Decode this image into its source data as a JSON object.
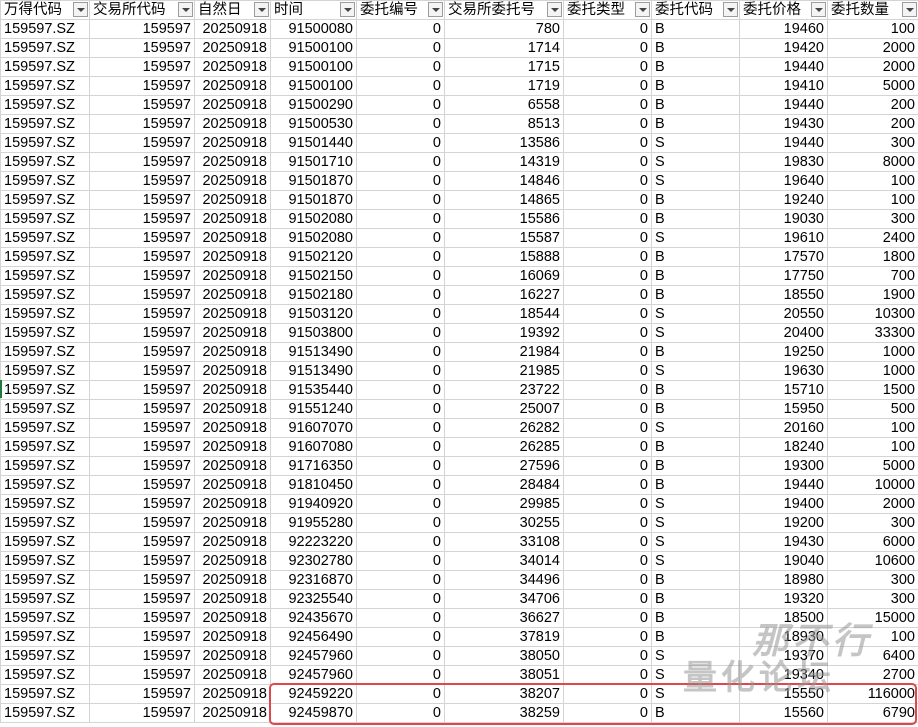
{
  "columns": [
    "万得代码",
    "交易所代码",
    "自然日",
    "时间",
    "委托编号",
    "交易所委托号",
    "委托类型",
    "委托代码",
    "委托价格",
    "委托数量"
  ],
  "rows": [
    [
      "159597.SZ",
      "159597",
      "20250918",
      "91500080",
      "0",
      "780",
      "0",
      "B",
      "19460",
      "100"
    ],
    [
      "159597.SZ",
      "159597",
      "20250918",
      "91500100",
      "0",
      "1714",
      "0",
      "B",
      "19420",
      "2000"
    ],
    [
      "159597.SZ",
      "159597",
      "20250918",
      "91500100",
      "0",
      "1715",
      "0",
      "B",
      "19440",
      "2000"
    ],
    [
      "159597.SZ",
      "159597",
      "20250918",
      "91500100",
      "0",
      "1719",
      "0",
      "B",
      "19410",
      "5000"
    ],
    [
      "159597.SZ",
      "159597",
      "20250918",
      "91500290",
      "0",
      "6558",
      "0",
      "B",
      "19440",
      "200"
    ],
    [
      "159597.SZ",
      "159597",
      "20250918",
      "91500530",
      "0",
      "8513",
      "0",
      "B",
      "19430",
      "200"
    ],
    [
      "159597.SZ",
      "159597",
      "20250918",
      "91501440",
      "0",
      "13586",
      "0",
      "S",
      "19440",
      "300"
    ],
    [
      "159597.SZ",
      "159597",
      "20250918",
      "91501710",
      "0",
      "14319",
      "0",
      "S",
      "19830",
      "8000"
    ],
    [
      "159597.SZ",
      "159597",
      "20250918",
      "91501870",
      "0",
      "14846",
      "0",
      "S",
      "19640",
      "100"
    ],
    [
      "159597.SZ",
      "159597",
      "20250918",
      "91501870",
      "0",
      "14865",
      "0",
      "B",
      "19240",
      "100"
    ],
    [
      "159597.SZ",
      "159597",
      "20250918",
      "91502080",
      "0",
      "15586",
      "0",
      "B",
      "19030",
      "300"
    ],
    [
      "159597.SZ",
      "159597",
      "20250918",
      "91502080",
      "0",
      "15587",
      "0",
      "S",
      "19610",
      "2400"
    ],
    [
      "159597.SZ",
      "159597",
      "20250918",
      "91502120",
      "0",
      "15888",
      "0",
      "B",
      "17570",
      "1800"
    ],
    [
      "159597.SZ",
      "159597",
      "20250918",
      "91502150",
      "0",
      "16069",
      "0",
      "B",
      "17750",
      "700"
    ],
    [
      "159597.SZ",
      "159597",
      "20250918",
      "91502180",
      "0",
      "16227",
      "0",
      "B",
      "18550",
      "1900"
    ],
    [
      "159597.SZ",
      "159597",
      "20250918",
      "91503120",
      "0",
      "18544",
      "0",
      "S",
      "20550",
      "10300"
    ],
    [
      "159597.SZ",
      "159597",
      "20250918",
      "91503800",
      "0",
      "19392",
      "0",
      "S",
      "20400",
      "33300"
    ],
    [
      "159597.SZ",
      "159597",
      "20250918",
      "91513490",
      "0",
      "21984",
      "0",
      "B",
      "19250",
      "1000"
    ],
    [
      "159597.SZ",
      "159597",
      "20250918",
      "91513490",
      "0",
      "21985",
      "0",
      "S",
      "19630",
      "1000"
    ],
    [
      "159597.SZ",
      "159597",
      "20250918",
      "91535440",
      "0",
      "23722",
      "0",
      "B",
      "15710",
      "1500"
    ],
    [
      "159597.SZ",
      "159597",
      "20250918",
      "91551240",
      "0",
      "25007",
      "0",
      "B",
      "15950",
      "500"
    ],
    [
      "159597.SZ",
      "159597",
      "20250918",
      "91607070",
      "0",
      "26282",
      "0",
      "S",
      "20160",
      "100"
    ],
    [
      "159597.SZ",
      "159597",
      "20250918",
      "91607080",
      "0",
      "26285",
      "0",
      "B",
      "18240",
      "100"
    ],
    [
      "159597.SZ",
      "159597",
      "20250918",
      "91716350",
      "0",
      "27596",
      "0",
      "B",
      "19300",
      "5000"
    ],
    [
      "159597.SZ",
      "159597",
      "20250918",
      "91810450",
      "0",
      "28484",
      "0",
      "B",
      "19440",
      "10000"
    ],
    [
      "159597.SZ",
      "159597",
      "20250918",
      "91940920",
      "0",
      "29985",
      "0",
      "S",
      "19400",
      "2000"
    ],
    [
      "159597.SZ",
      "159597",
      "20250918",
      "91955280",
      "0",
      "30255",
      "0",
      "S",
      "19200",
      "300"
    ],
    [
      "159597.SZ",
      "159597",
      "20250918",
      "92223220",
      "0",
      "33108",
      "0",
      "S",
      "19430",
      "6000"
    ],
    [
      "159597.SZ",
      "159597",
      "20250918",
      "92302780",
      "0",
      "34014",
      "0",
      "S",
      "19040",
      "10600"
    ],
    [
      "159597.SZ",
      "159597",
      "20250918",
      "92316870",
      "0",
      "34496",
      "0",
      "B",
      "18980",
      "300"
    ],
    [
      "159597.SZ",
      "159597",
      "20250918",
      "92325540",
      "0",
      "34706",
      "0",
      "B",
      "19320",
      "300"
    ],
    [
      "159597.SZ",
      "159597",
      "20250918",
      "92435670",
      "0",
      "36627",
      "0",
      "B",
      "18500",
      "15000"
    ],
    [
      "159597.SZ",
      "159597",
      "20250918",
      "92456490",
      "0",
      "37819",
      "0",
      "B",
      "18930",
      "100"
    ],
    [
      "159597.SZ",
      "159597",
      "20250918",
      "92457960",
      "0",
      "38050",
      "0",
      "S",
      "19370",
      "6400"
    ],
    [
      "159597.SZ",
      "159597",
      "20250918",
      "92457960",
      "0",
      "38051",
      "0",
      "S",
      "19340",
      "2700"
    ],
    [
      "159597.SZ",
      "159597",
      "20250918",
      "92459220",
      "0",
      "38207",
      "0",
      "S",
      "15550",
      "116000"
    ],
    [
      "159597.SZ",
      "159597",
      "20250918",
      "92459870",
      "0",
      "38259",
      "0",
      "B",
      "15560",
      "6790"
    ]
  ],
  "watermark": {
    "line1": "那不行",
    "line2": "量化论坛"
  },
  "colors": {
    "highlight_border": "#e0474c",
    "grid": "#d4d4d4",
    "watermark": "#969696"
  }
}
